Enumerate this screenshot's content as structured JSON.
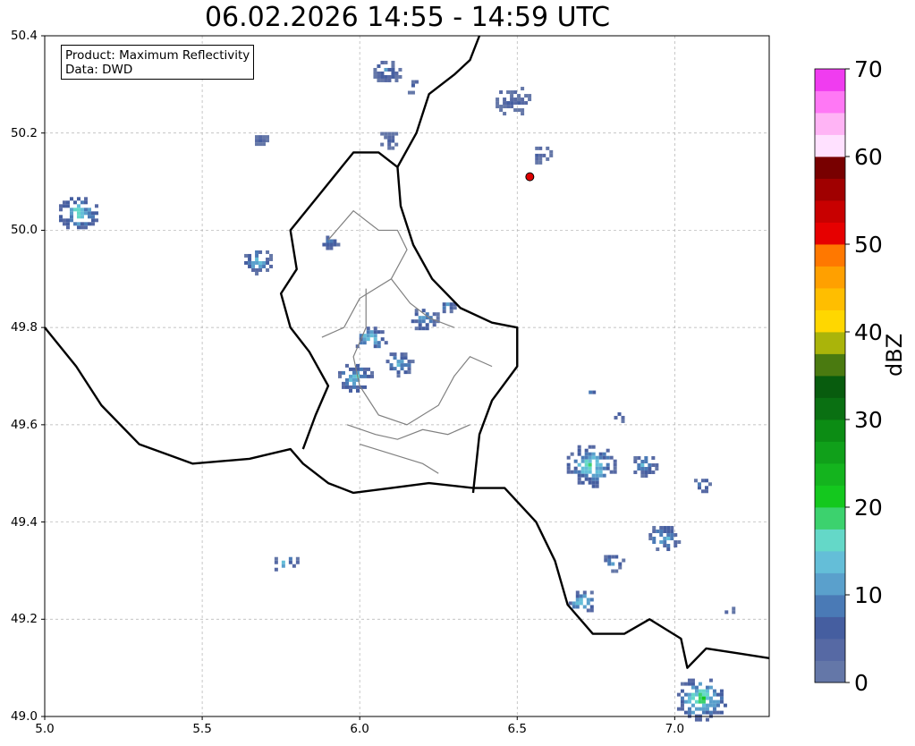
{
  "title": "06.02.2026 14:55 - 14:59 UTC",
  "info": {
    "product": "Product: Maximum Reflectivity",
    "data": "Data: DWD"
  },
  "axes": {
    "lon_range": [
      5.0,
      7.3
    ],
    "lat_range": [
      49.0,
      50.4
    ],
    "x_ticks": [
      "5.0",
      "5.5",
      "6.0",
      "6.5",
      "7.0"
    ],
    "y_ticks": [
      "50.4",
      "50.2",
      "50.0",
      "49.8",
      "49.6",
      "49.4",
      "49.2",
      "49.0"
    ],
    "grid": true
  },
  "marker": {
    "lon": 6.54,
    "lat": 50.11,
    "color": "#dd0000"
  },
  "colorbar": {
    "label": "dBZ",
    "min": 0,
    "max": 70,
    "step": 2.5,
    "ticks": [
      "0",
      "10",
      "20",
      "30",
      "40",
      "50",
      "60",
      "70"
    ],
    "colors": [
      "#6477a8",
      "#5669a4",
      "#455ea0",
      "#4a7ab6",
      "#5aa0cc",
      "#64bed8",
      "#64d8c8",
      "#3cd26e",
      "#14c81e",
      "#14b41e",
      "#10a01a",
      "#0c8c14",
      "#0a7012",
      "#085c0e",
      "#4a7a10",
      "#aab40a",
      "#ffd700",
      "#ffbe00",
      "#ffa000",
      "#ff7800",
      "#e60000",
      "#c80000",
      "#a00000",
      "#780000",
      "#ffe1ff",
      "#ffb4f5",
      "#ff78f5",
      "#f03cf0"
    ]
  },
  "echoes": [
    {
      "lon": 5.1,
      "lat": 50.04,
      "r": 0.055,
      "dbz": 20
    },
    {
      "lon": 5.67,
      "lat": 49.94,
      "r": 0.04,
      "dbz": 18
    },
    {
      "lon": 5.76,
      "lat": 49.32,
      "r": 0.035,
      "dbz": 16
    },
    {
      "lon": 5.68,
      "lat": 50.19,
      "r": 0.02,
      "dbz": 10
    },
    {
      "lon": 5.9,
      "lat": 49.98,
      "r": 0.025,
      "dbz": 14
    },
    {
      "lon": 6.08,
      "lat": 50.33,
      "r": 0.04,
      "dbz": 12
    },
    {
      "lon": 6.16,
      "lat": 50.3,
      "r": 0.025,
      "dbz": 10
    },
    {
      "lon": 6.09,
      "lat": 50.19,
      "r": 0.03,
      "dbz": 8
    },
    {
      "lon": 6.03,
      "lat": 49.78,
      "r": 0.045,
      "dbz": 20
    },
    {
      "lon": 5.98,
      "lat": 49.7,
      "r": 0.05,
      "dbz": 18
    },
    {
      "lon": 6.12,
      "lat": 49.73,
      "r": 0.04,
      "dbz": 18
    },
    {
      "lon": 6.2,
      "lat": 49.82,
      "r": 0.04,
      "dbz": 16
    },
    {
      "lon": 6.27,
      "lat": 49.85,
      "r": 0.025,
      "dbz": 14
    },
    {
      "lon": 6.48,
      "lat": 50.27,
      "r": 0.05,
      "dbz": 8
    },
    {
      "lon": 6.57,
      "lat": 50.16,
      "r": 0.03,
      "dbz": 8
    },
    {
      "lon": 6.73,
      "lat": 49.52,
      "r": 0.07,
      "dbz": 20
    },
    {
      "lon": 6.9,
      "lat": 49.52,
      "r": 0.035,
      "dbz": 16
    },
    {
      "lon": 7.08,
      "lat": 49.48,
      "r": 0.025,
      "dbz": 14
    },
    {
      "lon": 6.96,
      "lat": 49.37,
      "r": 0.045,
      "dbz": 16
    },
    {
      "lon": 6.8,
      "lat": 49.32,
      "r": 0.03,
      "dbz": 14
    },
    {
      "lon": 6.7,
      "lat": 49.24,
      "r": 0.04,
      "dbz": 20
    },
    {
      "lon": 6.82,
      "lat": 49.62,
      "r": 0.02,
      "dbz": 10
    },
    {
      "lon": 6.73,
      "lat": 49.67,
      "r": 0.012,
      "dbz": 14
    },
    {
      "lon": 7.16,
      "lat": 49.22,
      "r": 0.02,
      "dbz": 8
    },
    {
      "lon": 7.08,
      "lat": 49.04,
      "r": 0.07,
      "dbz": 22
    }
  ],
  "borders": {
    "main": [
      [
        5.0,
        49.8
      ],
      [
        5.1,
        49.72
      ],
      [
        5.18,
        49.64
      ],
      [
        5.3,
        49.56
      ],
      [
        5.47,
        49.52
      ],
      [
        5.65,
        49.53
      ],
      [
        5.78,
        49.55
      ],
      [
        5.82,
        49.52
      ],
      [
        5.9,
        49.48
      ],
      [
        5.98,
        49.46
      ],
      [
        6.1,
        49.47
      ],
      [
        6.22,
        49.48
      ],
      [
        6.36,
        49.47
      ],
      [
        6.46,
        49.47
      ],
      [
        6.56,
        49.4
      ],
      [
        6.62,
        49.32
      ],
      [
        6.66,
        49.23
      ],
      [
        6.74,
        49.17
      ],
      [
        6.84,
        49.17
      ],
      [
        6.92,
        49.2
      ],
      [
        7.02,
        49.16
      ],
      [
        7.04,
        49.1
      ],
      [
        7.1,
        49.14
      ],
      [
        7.2,
        49.13
      ],
      [
        7.3,
        49.12
      ]
    ],
    "lux": [
      [
        5.82,
        49.55
      ],
      [
        5.86,
        49.62
      ],
      [
        5.9,
        49.68
      ],
      [
        5.84,
        49.75
      ],
      [
        5.78,
        49.8
      ],
      [
        5.75,
        49.87
      ],
      [
        5.8,
        49.92
      ],
      [
        5.78,
        50.0
      ],
      [
        5.88,
        50.08
      ],
      [
        5.98,
        50.16
      ],
      [
        6.06,
        50.16
      ],
      [
        6.12,
        50.13
      ],
      [
        6.13,
        50.05
      ],
      [
        6.17,
        49.97
      ],
      [
        6.23,
        49.9
      ],
      [
        6.32,
        49.84
      ],
      [
        6.42,
        49.81
      ],
      [
        6.5,
        49.8
      ],
      [
        6.5,
        49.72
      ],
      [
        6.42,
        49.65
      ],
      [
        6.38,
        49.58
      ],
      [
        6.36,
        49.46
      ]
    ],
    "north": [
      [
        6.12,
        50.13
      ],
      [
        6.18,
        50.2
      ],
      [
        6.22,
        50.28
      ],
      [
        6.3,
        50.32
      ],
      [
        6.35,
        50.35
      ],
      [
        6.38,
        50.4
      ]
    ]
  },
  "districts": [
    [
      [
        5.9,
        49.98
      ],
      [
        5.98,
        50.04
      ],
      [
        6.06,
        50.0
      ],
      [
        6.12,
        50.0
      ],
      [
        6.15,
        49.96
      ],
      [
        6.1,
        49.9
      ],
      [
        6.0,
        49.86
      ],
      [
        5.95,
        49.8
      ],
      [
        5.88,
        49.78
      ]
    ],
    [
      [
        6.02,
        49.88
      ],
      [
        6.02,
        49.8
      ],
      [
        5.98,
        49.74
      ],
      [
        6.0,
        49.68
      ],
      [
        6.06,
        49.62
      ],
      [
        6.15,
        49.6
      ],
      [
        6.25,
        49.64
      ],
      [
        6.3,
        49.7
      ],
      [
        6.35,
        49.74
      ],
      [
        6.42,
        49.72
      ]
    ],
    [
      [
        6.1,
        49.9
      ],
      [
        6.16,
        49.85
      ],
      [
        6.22,
        49.82
      ],
      [
        6.3,
        49.8
      ]
    ],
    [
      [
        5.96,
        49.6
      ],
      [
        6.05,
        49.58
      ],
      [
        6.12,
        49.57
      ],
      [
        6.2,
        49.59
      ],
      [
        6.28,
        49.58
      ],
      [
        6.35,
        49.6
      ]
    ],
    [
      [
        6.0,
        49.56
      ],
      [
        6.1,
        49.54
      ],
      [
        6.2,
        49.52
      ],
      [
        6.25,
        49.5
      ]
    ]
  ]
}
